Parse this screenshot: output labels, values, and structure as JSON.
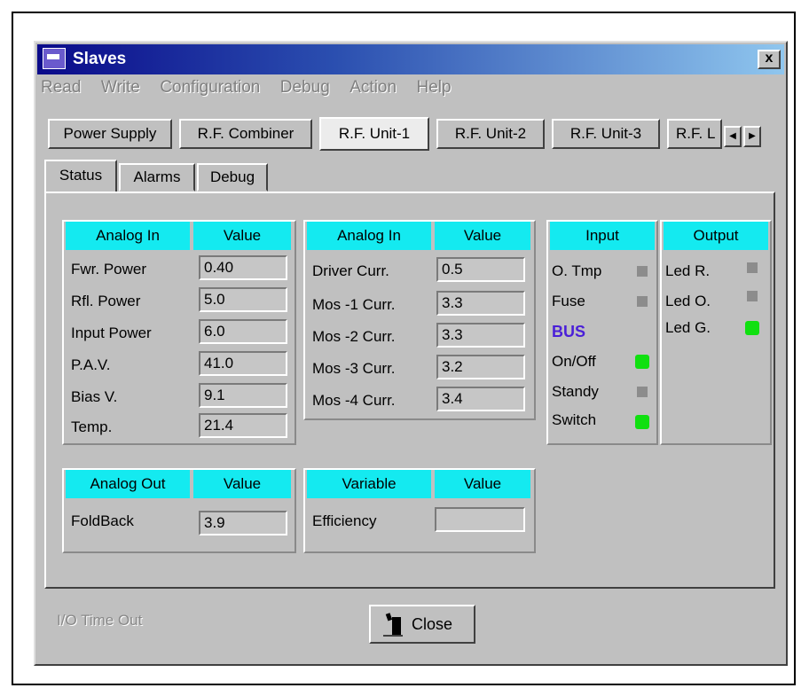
{
  "window": {
    "title": "Slaves",
    "close_glyph": "x"
  },
  "menu": [
    "Read",
    "Write",
    "Configuration",
    "Debug",
    "Action",
    "Help"
  ],
  "top_tabs": [
    "Power Supply",
    "R.F. Combiner",
    "R.F. Unit-1",
    "R.F. Unit-2",
    "R.F. Unit-3",
    "R.F. L"
  ],
  "top_tabs_active": "R.F. Unit-1",
  "scroll": {
    "left": "◀",
    "right": "▶"
  },
  "sub_tabs": [
    "Status",
    "Alarms",
    "Debug"
  ],
  "analog_in_1": {
    "header": [
      "Analog In",
      "Value"
    ],
    "rows": [
      {
        "label": "Fwr. Power",
        "value": "0.40"
      },
      {
        "label": "Rfl. Power",
        "value": "5.0"
      },
      {
        "label": "Input Power",
        "value": "6.0"
      },
      {
        "label": "P.A.V.",
        "value": "41.0"
      },
      {
        "label": "Bias V.",
        "value": "9.1"
      },
      {
        "label": "Temp.",
        "value": "21.4"
      }
    ]
  },
  "analog_in_2": {
    "header": [
      "Analog In",
      "Value"
    ],
    "rows": [
      {
        "label": "Driver Curr.",
        "value": "0.5"
      },
      {
        "label": "Mos -1  Curr.",
        "value": "3.3"
      },
      {
        "label": "Mos -2  Curr.",
        "value": "3.3"
      },
      {
        "label": "Mos -3  Curr.",
        "value": "3.2"
      },
      {
        "label": "Mos -4  Curr.",
        "value": "3.4"
      }
    ]
  },
  "input": {
    "header": "Input",
    "rows": [
      {
        "label": "O. Tmp",
        "state": "gray"
      },
      {
        "label": "Fuse",
        "state": "gray"
      }
    ],
    "bus_label": "BUS",
    "bus_rows": [
      {
        "label": "On/Off",
        "state": "green"
      },
      {
        "label": "Standy",
        "state": "gray"
      },
      {
        "label": "Switch",
        "state": "green"
      }
    ]
  },
  "output": {
    "header": "Output",
    "rows": [
      {
        "label": "Led R.",
        "state": "gray"
      },
      {
        "label": "Led O.",
        "state": "gray"
      },
      {
        "label": "Led G.",
        "state": "green"
      }
    ]
  },
  "analog_out": {
    "header": [
      "Analog Out",
      "Value"
    ],
    "rows": [
      {
        "label": "FoldBack",
        "value": "3.9"
      }
    ]
  },
  "variable": {
    "header": [
      "Variable",
      "Value"
    ],
    "rows": [
      {
        "label": "Efficiency",
        "value": ""
      }
    ]
  },
  "status": {
    "text": "I/O Time Out",
    "close_label": "Close"
  }
}
